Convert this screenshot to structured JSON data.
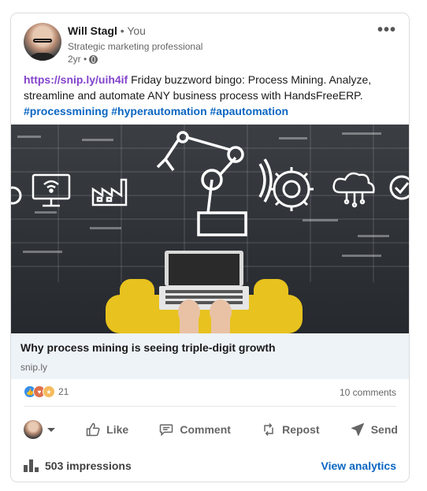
{
  "post": {
    "author_name": "Will Stagl",
    "relation": " • You",
    "headline": "Strategic marketing professional",
    "time": "2yr •",
    "more_label": "•••",
    "link": "https://snip.ly/uih4if",
    "text_body": " Friday buzzword bingo: Process Mining. Analyze, streamline and automate ANY business process with HandsFreeERP.",
    "hashtags": [
      "#processmining",
      "#hyperautomation",
      "#apautomation"
    ]
  },
  "image": {
    "icons": [
      "wifi-monitor-icon",
      "factory-icon",
      "robot-arm-icon",
      "gear-icon",
      "cloud-network-icon",
      "laptop-icon"
    ],
    "colors": {
      "background": "#2e3237",
      "chair": "#e8c21e",
      "lines": "#ffffff"
    }
  },
  "preview": {
    "title": "Why process mining is seeing triple-digit growth",
    "domain": "snip.ly"
  },
  "social": {
    "reaction_count": "21",
    "comments": "10 comments"
  },
  "actions": {
    "like": "Like",
    "comment": "Comment",
    "repost": "Repost",
    "send": "Send"
  },
  "analytics": {
    "impressions": "503 impressions",
    "view_label": "View analytics"
  },
  "colors": {
    "link": "#8344cc",
    "hashtag": "#0a66c2",
    "accent": "#0a66c2",
    "preview_bg": "#eef3f8"
  }
}
